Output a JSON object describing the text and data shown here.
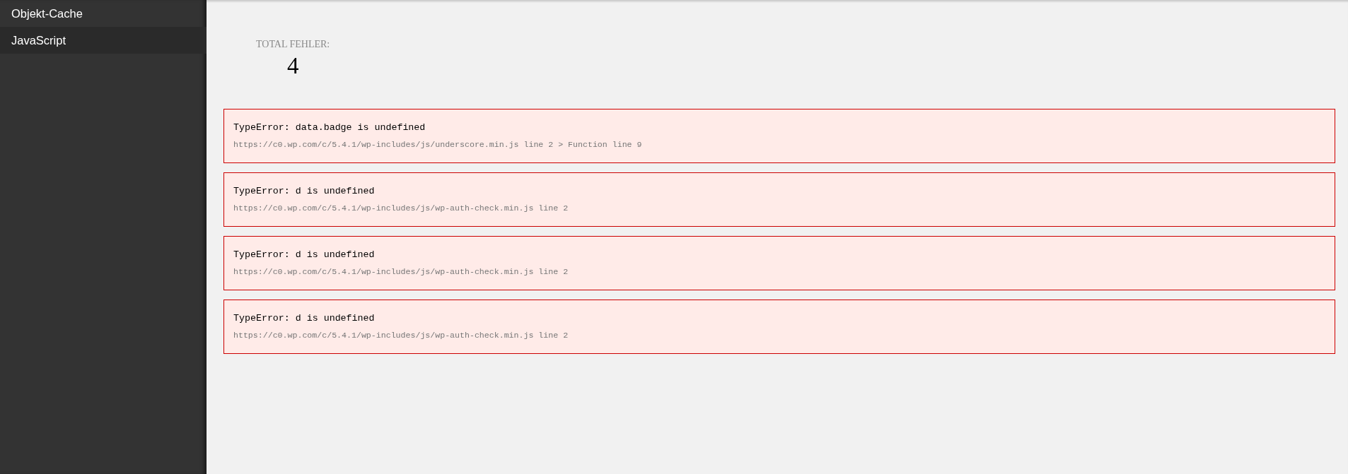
{
  "sidebar": {
    "items": [
      {
        "label": "Objekt-Cache",
        "selected": false
      },
      {
        "label": "JavaScript",
        "selected": true
      }
    ]
  },
  "summary": {
    "label": "TOTAL FEHLER:",
    "value": "4"
  },
  "errors": [
    {
      "message": "TypeError: data.badge is undefined",
      "source": "https://c0.wp.com/c/5.4.1/wp-includes/js/underscore.min.js line 2 > Function line 9"
    },
    {
      "message": "TypeError: d is undefined",
      "source": "https://c0.wp.com/c/5.4.1/wp-includes/js/wp-auth-check.min.js line 2"
    },
    {
      "message": "TypeError: d is undefined",
      "source": "https://c0.wp.com/c/5.4.1/wp-includes/js/wp-auth-check.min.js line 2"
    },
    {
      "message": "TypeError: d is undefined",
      "source": "https://c0.wp.com/c/5.4.1/wp-includes/js/wp-auth-check.min.js line 2"
    }
  ]
}
